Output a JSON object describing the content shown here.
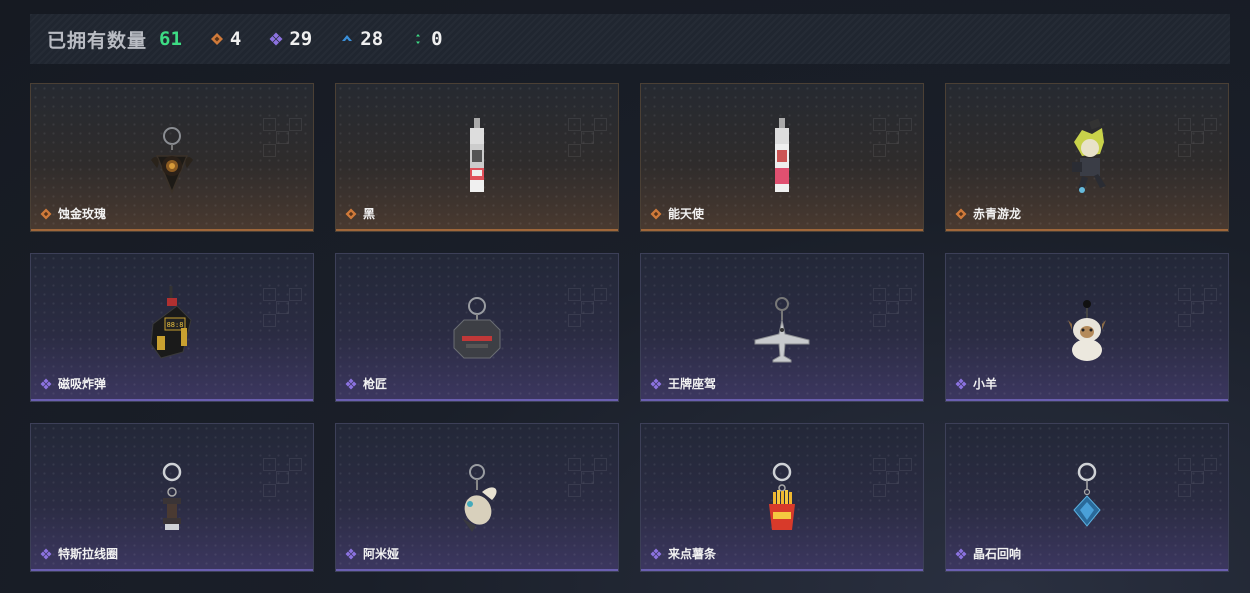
{
  "summary": {
    "title": "已拥有数量",
    "total": "61",
    "stats": [
      {
        "icon": "orange-diamond-icon",
        "value": "4",
        "color": "#d07a3a"
      },
      {
        "icon": "purple-diamond-icon",
        "value": "29",
        "color": "#8c72e0"
      },
      {
        "icon": "blue-chevron-icon",
        "value": "28",
        "color": "#3a8fd9"
      },
      {
        "icon": "green-dots-icon",
        "value": "0",
        "color": "#3ddc84"
      }
    ]
  },
  "items": [
    {
      "name": "蚀金玫瑰",
      "rarity": "orange",
      "icon": "rose-pendant-icon"
    },
    {
      "name": "黑",
      "rarity": "orange",
      "icon": "card-tag-icon"
    },
    {
      "name": "能天使",
      "rarity": "orange",
      "icon": "card-tag-icon"
    },
    {
      "name": "赤青游龙",
      "rarity": "orange",
      "icon": "figure-charm-icon"
    },
    {
      "name": "磁吸炸弹",
      "rarity": "purple",
      "icon": "bomb-charm-icon"
    },
    {
      "name": "枪匠",
      "rarity": "purple",
      "icon": "badge-charm-icon"
    },
    {
      "name": "王牌座驾",
      "rarity": "purple",
      "icon": "plane-charm-icon"
    },
    {
      "name": "小羊",
      "rarity": "purple",
      "icon": "sheep-charm-icon"
    },
    {
      "name": "特斯拉线圈",
      "rarity": "purple",
      "icon": "tesla-coil-charm-icon"
    },
    {
      "name": "阿米娅",
      "rarity": "purple",
      "icon": "bunny-charm-icon"
    },
    {
      "name": "来点薯条",
      "rarity": "purple",
      "icon": "fries-charm-icon"
    },
    {
      "name": "晶石回响",
      "rarity": "purple",
      "icon": "crystal-charm-icon"
    }
  ]
}
